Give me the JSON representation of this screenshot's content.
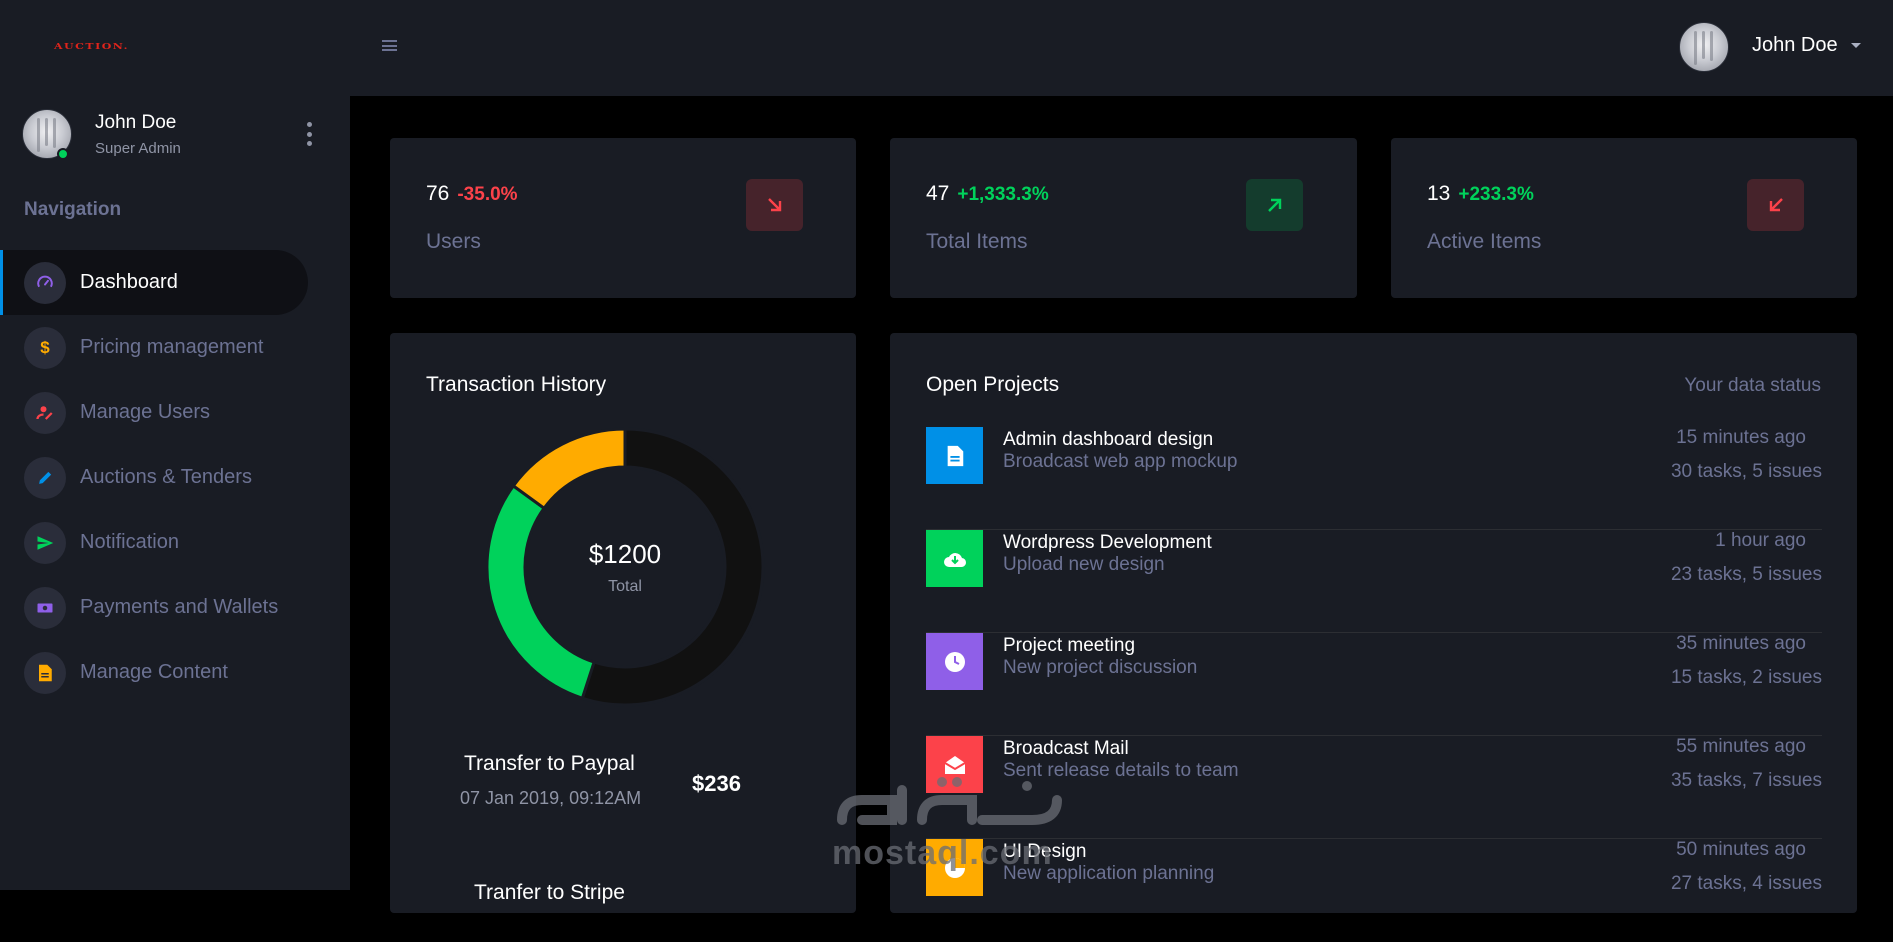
{
  "brand": {
    "logo_text": "AUCTION."
  },
  "sidebar": {
    "profile": {
      "name": "John Doe",
      "role": "Super Admin"
    },
    "nav_heading": "Navigation",
    "items": [
      {
        "label": "Dashboard",
        "icon": "speedometer-icon",
        "active": true,
        "color": "#8f5fe8"
      },
      {
        "label": "Pricing management",
        "icon": "dollar-icon",
        "active": false,
        "color": "#ffab00"
      },
      {
        "label": "Manage Users",
        "icon": "user-edit-icon",
        "active": false,
        "color": "#fc424a"
      },
      {
        "label": "Auctions & Tenders",
        "icon": "pencil-icon",
        "active": false,
        "color": "#0090e7"
      },
      {
        "label": "Notification",
        "icon": "send-icon",
        "active": false,
        "color": "#00d25b"
      },
      {
        "label": "Payments and Wallets",
        "icon": "cash-icon",
        "active": false,
        "color": "#8f5fe8"
      },
      {
        "label": "Manage Content",
        "icon": "file-icon",
        "active": false,
        "color": "#ffab00"
      }
    ]
  },
  "topbar": {
    "user_name": "John Doe"
  },
  "stats": [
    {
      "value": "76",
      "change": "-35.0%",
      "trend": "down",
      "label": "Users",
      "icon": "arrow-bottom-right-icon"
    },
    {
      "value": "47",
      "change": "+1,333.3%",
      "trend": "up",
      "label": "Total Items",
      "icon": "arrow-top-right-icon"
    },
    {
      "value": "13",
      "change": "+233.3%",
      "trend": "down",
      "label": "Active Items",
      "icon": "arrow-bottom-left-icon"
    }
  ],
  "transactions": {
    "title": "Transaction History",
    "total_amount": "$1200",
    "total_label": "Total",
    "items": [
      {
        "title": "Transfer to Paypal",
        "date": "07 Jan 2019, 09:12AM",
        "amount": "$236"
      },
      {
        "title": "Tranfer to Stripe"
      }
    ]
  },
  "chart_data": {
    "type": "pie",
    "categories": [
      "",
      "",
      ""
    ],
    "values": [
      55,
      30,
      15
    ],
    "colors": [
      "#111111",
      "#00d25b",
      "#ffab00"
    ]
  },
  "projects": {
    "title": "Open Projects",
    "status_link": "Your data status",
    "items": [
      {
        "title": "Admin dashboard design",
        "subtitle": "Broadcast web app mockup",
        "time": "15 minutes ago",
        "tasks": "30 tasks, 5 issues",
        "color": "#0090e7",
        "icon": "document-icon"
      },
      {
        "title": "Wordpress Development",
        "subtitle": "Upload new design",
        "time": "1 hour ago",
        "tasks": "23 tasks, 5 issues",
        "color": "#00d25b",
        "icon": "cloud-download-icon"
      },
      {
        "title": "Project meeting",
        "subtitle": "New project discussion",
        "time": "35 minutes ago",
        "tasks": "15 tasks, 2 issues",
        "color": "#8f5fe8",
        "icon": "clock-icon"
      },
      {
        "title": "Broadcast Mail",
        "subtitle": "Sent release details to team",
        "time": "55 minutes ago",
        "tasks": "35 tasks, 7 issues",
        "color": "#fc424a",
        "icon": "email-open-icon"
      },
      {
        "title": "UI Design",
        "subtitle": "New application planning",
        "time": "50 minutes ago",
        "tasks": "27 tasks, 4 issues",
        "color": "#ffab00",
        "icon": "chart-pie-icon"
      }
    ]
  },
  "watermark": {
    "latin": "mostaql.com"
  }
}
